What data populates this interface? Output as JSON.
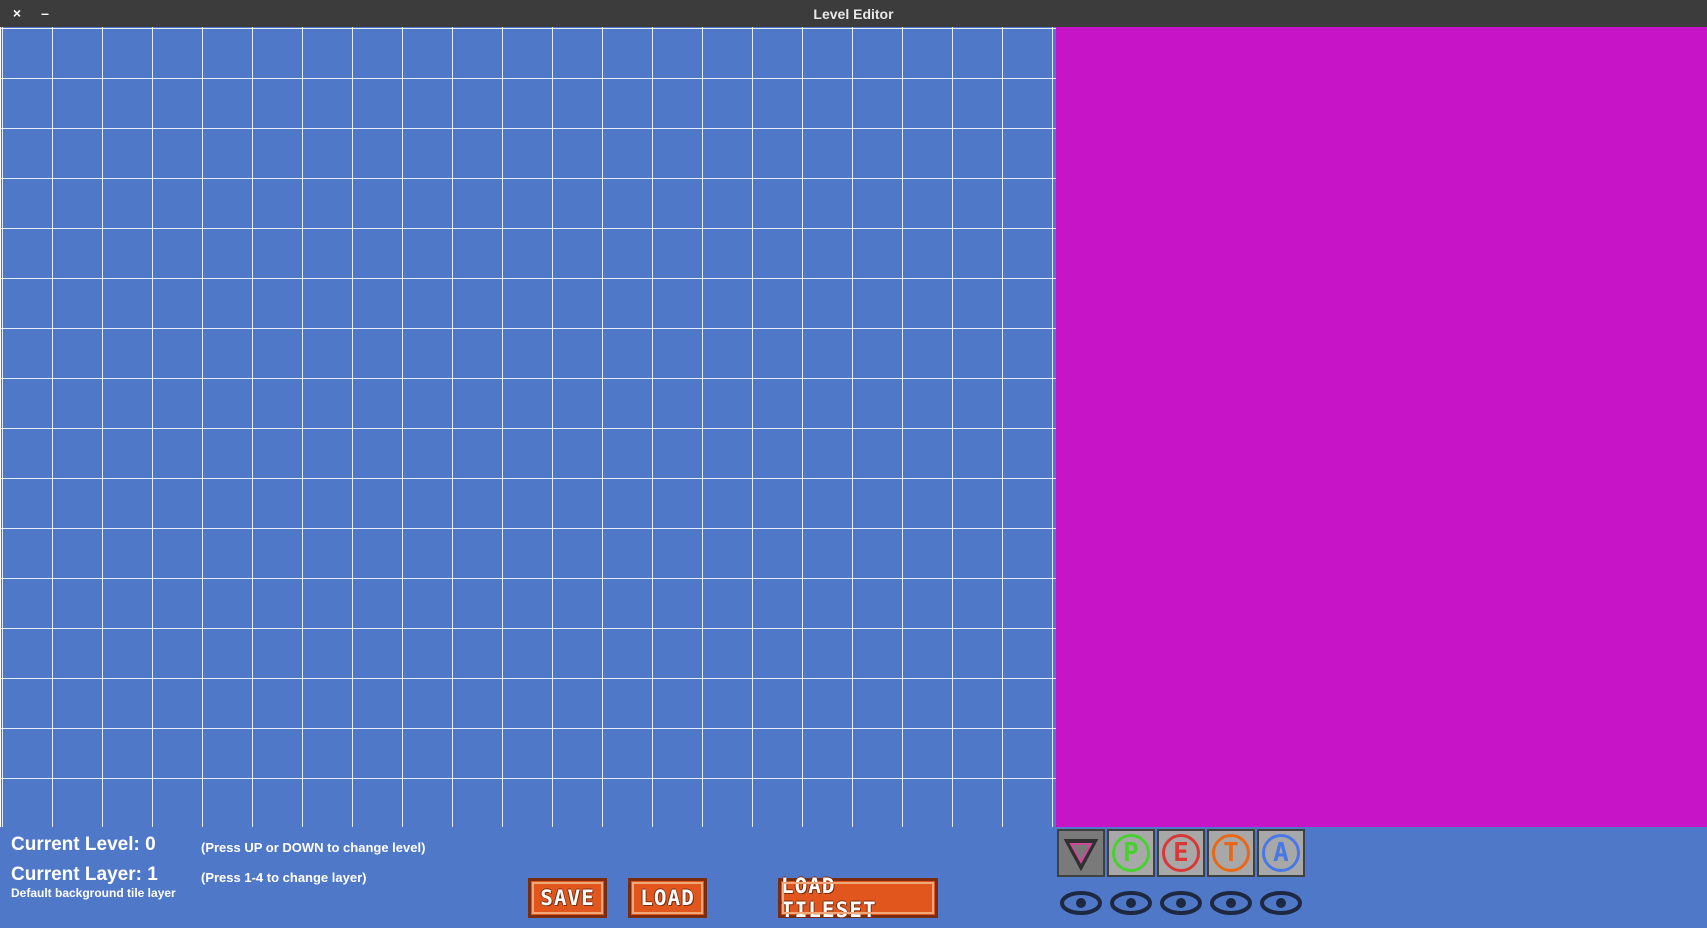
{
  "window": {
    "title": "Level Editor",
    "close_glyph": "×",
    "minimize_glyph": "–"
  },
  "status": {
    "level_label": "Current Level: 0",
    "level_hint": "(Press UP or DOWN to change level)",
    "layer_label": "Current Layer: 1",
    "layer_hint": "(Press 1-4 to change layer)",
    "layer_description": "Default background tile layer"
  },
  "buttons": {
    "save": "SAVE",
    "load": "LOAD",
    "load_tileset": "LOAD TILESET"
  },
  "layers": [
    {
      "name": "background",
      "icon": "triangle-icon",
      "letter": "",
      "color": "#d04898",
      "active": true
    },
    {
      "name": "player",
      "icon": "p-icon",
      "letter": "P",
      "color": "#48d030",
      "active": false
    },
    {
      "name": "enemy",
      "icon": "e-icon",
      "letter": "E",
      "color": "#d83838",
      "active": false
    },
    {
      "name": "trigger",
      "icon": "t-icon",
      "letter": "T",
      "color": "#e86818",
      "active": false
    },
    {
      "name": "area",
      "icon": "a-icon",
      "letter": "A",
      "color": "#4878e8",
      "active": false
    }
  ],
  "colors": {
    "grid_background": "#5078c8",
    "tileset_background": "#c614c6",
    "button_orange": "#e0561c"
  }
}
